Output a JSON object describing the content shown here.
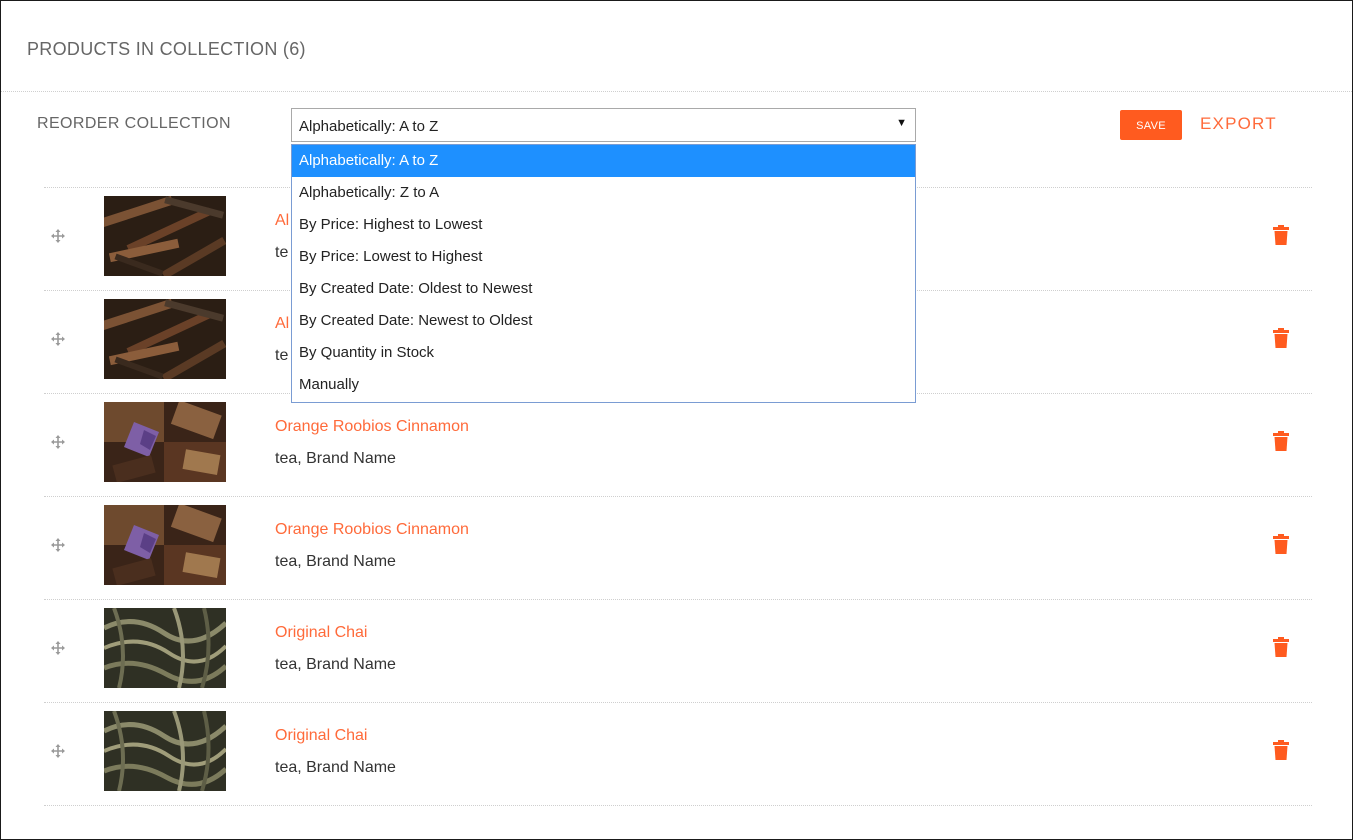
{
  "panel": {
    "title": "PRODUCTS IN COLLECTION (6)"
  },
  "toolbar": {
    "reorder_label": "REORDER COLLECTION",
    "sort_selected": "Alphabetically: A to Z",
    "sort_options": [
      "Alphabetically: A to Z",
      "Alphabetically: Z to A",
      "By Price: Highest to Lowest",
      "By Price: Lowest to Highest",
      "By Created Date: Oldest to Newest",
      "By Created Date: Newest to Oldest",
      "By Quantity in Stock",
      "Manually"
    ],
    "save_label": "SAVE",
    "export_label": "EXPORT"
  },
  "products": [
    {
      "name": "Al",
      "meta": "te",
      "image": "cinnamon-tea"
    },
    {
      "name": "Al",
      "meta": "te",
      "image": "cinnamon-tea"
    },
    {
      "name": "Orange Roobios Cinnamon",
      "meta": "tea, Brand Name",
      "image": "rooibos-tea"
    },
    {
      "name": "Orange Roobios Cinnamon",
      "meta": "tea, Brand Name",
      "image": "rooibos-tea"
    },
    {
      "name": "Original Chai",
      "meta": "tea, Brand Name",
      "image": "chai-tea"
    },
    {
      "name": "Original Chai",
      "meta": "tea, Brand Name",
      "image": "chai-tea"
    }
  ],
  "colors": {
    "accent": "#ff6a3a",
    "save_button": "#ff5b1f",
    "selected_option": "#1e90ff",
    "trash": "#ff5b1f"
  },
  "icons": {
    "drag": "move-icon",
    "delete": "trash-icon",
    "dropdown": "caret-down-icon"
  }
}
